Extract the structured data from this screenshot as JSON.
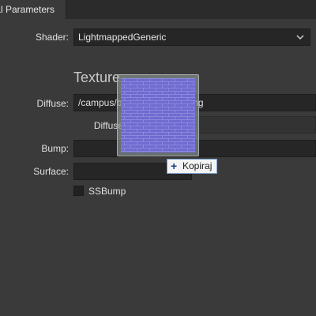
{
  "tab": {
    "label": "Material Parameters"
  },
  "shader": {
    "label": "Shader:",
    "value": "LightmappedGeneric",
    "dropdown_icon": "chevron-down-icon"
  },
  "texture_section": {
    "title": "Texture"
  },
  "diffuse": {
    "label": "Diffuse:",
    "value": "/campus/bricks01_diffuse.png"
  },
  "diffuse_alpha": {
    "label": "Diffuse alpha:"
  },
  "bump": {
    "label": "Bump:",
    "value": ""
  },
  "surface": {
    "label": "Surface:",
    "value": ""
  },
  "ssbump": {
    "label": "SSBump",
    "checked": false
  },
  "drag_preview": {
    "icon": "brick-texture-thumbnail",
    "color": "#6c68cc"
  },
  "copy_badge": {
    "icon": "plus-icon",
    "label": "Kopiraj"
  },
  "colors": {
    "background": "#3a3a3a",
    "field": "#262626",
    "text": "#dedede"
  }
}
